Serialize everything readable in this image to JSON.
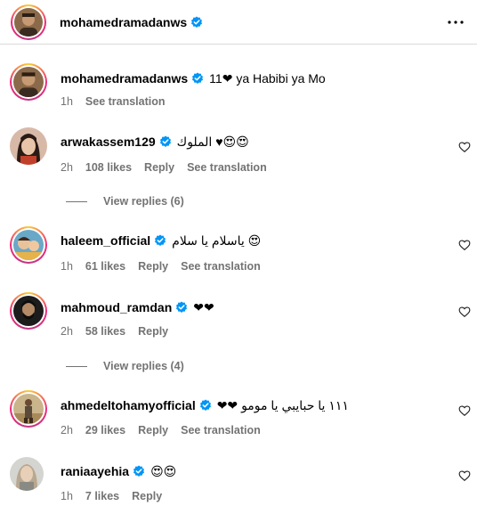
{
  "post": {
    "author": "mohamedramadanws",
    "more_icon": "more-horizontal-icon"
  },
  "caption": {
    "author": "mohamedramadanws",
    "text": "11❤ ya Habibi ya Mo",
    "time": "1h",
    "see_translation": "See translation"
  },
  "comments": [
    {
      "username": "arwakassem129",
      "text": "الملوك ♥😍😍",
      "time": "2h",
      "likes": "108 likes",
      "reply": "Reply",
      "see_translation": "See translation",
      "view_replies": "View replies (6)"
    },
    {
      "username": "haleem_official",
      "text": "ياسلام يا سلام 😍",
      "time": "1h",
      "likes": "61 likes",
      "reply": "Reply",
      "see_translation": "See translation"
    },
    {
      "username": "mahmoud_ramdan",
      "text": "❤❤",
      "time": "2h",
      "likes": "58 likes",
      "reply": "Reply",
      "view_replies": "View replies (4)"
    },
    {
      "username": "ahmedeltohamyofficial",
      "text": "❤❤ ١١١ يا حبايبي يا مومو",
      "time": "2h",
      "likes": "29 likes",
      "reply": "Reply",
      "see_translation": "See translation"
    },
    {
      "username": "raniaayehia",
      "text": "😍😍",
      "time": "1h",
      "likes": "7 likes",
      "reply": "Reply"
    }
  ],
  "colors": {
    "verified": "#0095f6",
    "muted": "#737373",
    "divider": "#dbdbdb"
  }
}
